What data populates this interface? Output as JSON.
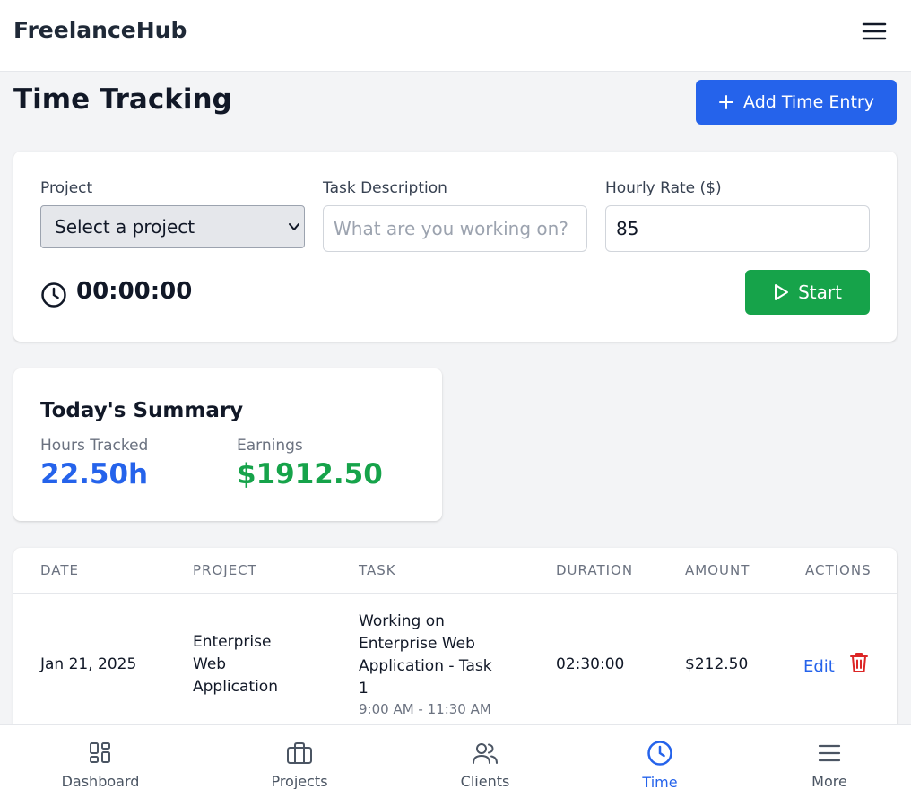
{
  "app": {
    "title": "FreelanceHub"
  },
  "page": {
    "title": "Time Tracking",
    "add_button_label": "Add Time Entry"
  },
  "timer": {
    "project_label": "Project",
    "project_selected": "Select a project",
    "task_label": "Task Description",
    "task_placeholder": "What are you working on?",
    "task_value": "",
    "rate_label": "Hourly Rate ($)",
    "rate_value": "85",
    "elapsed": "00:00:00",
    "start_label": "Start"
  },
  "summary": {
    "title": "Today's Summary",
    "hours_label": "Hours Tracked",
    "hours_value": "22.50h",
    "earnings_label": "Earnings",
    "earnings_value": "$1912.50"
  },
  "table": {
    "headers": [
      "DATE",
      "PROJECT",
      "TASK",
      "DURATION",
      "AMOUNT",
      "ACTIONS"
    ],
    "rows": [
      {
        "date": "Jan 21, 2025",
        "project_lines": [
          "Enterprise",
          "Web",
          "Application"
        ],
        "task_lines": [
          "Working on",
          "Enterprise Web",
          "Application - Task",
          "1"
        ],
        "time_range": "9:00 AM - 11:30 AM",
        "duration": "02:30:00",
        "amount": "$212.50",
        "edit_label": "Edit"
      }
    ]
  },
  "nav": {
    "items": [
      {
        "label": "Dashboard",
        "icon": "dashboard-icon"
      },
      {
        "label": "Projects",
        "icon": "briefcase-icon"
      },
      {
        "label": "Clients",
        "icon": "users-icon"
      },
      {
        "label": "Time",
        "icon": "clock-icon"
      },
      {
        "label": "More",
        "icon": "menu-icon"
      }
    ],
    "active": "Time"
  },
  "colors": {
    "primary": "#2563eb",
    "success": "#16a34a",
    "danger": "#dc2626",
    "background": "#f3f4f6"
  }
}
